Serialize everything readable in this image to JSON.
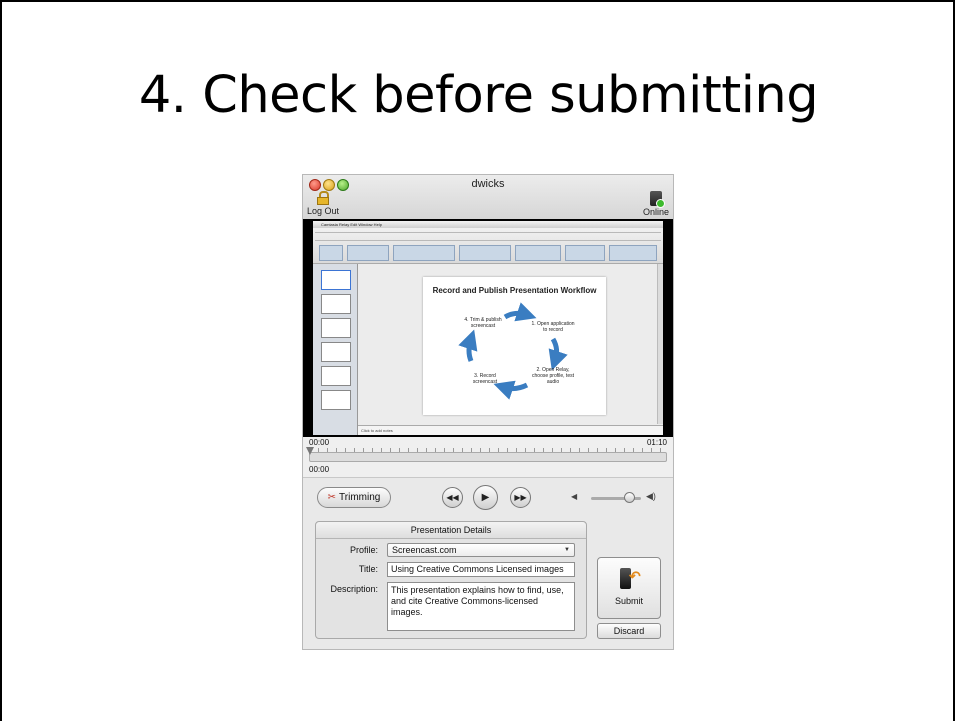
{
  "slide": {
    "title": "4. Check before submitting"
  },
  "window": {
    "title": "dwicks",
    "log_out_label": "Log Out",
    "online_label": "Online"
  },
  "recording": {
    "menubar_text": "Camtasia Relay   Edit   Window   Help",
    "slide_title": "Record and Publish Presentation Workflow",
    "workflow_steps": [
      "1. Open application to record",
      "2. Open Relay, choose profile, test audio",
      "3. Record screencast",
      "4. Trim & publish screencast"
    ],
    "notes_text": "Click to add notes"
  },
  "timeline": {
    "start_time": "00:00",
    "end_time": "01:10",
    "current_time": "00:00"
  },
  "controls": {
    "trim_label": "Trimming",
    "rewind_icon": "rewind-icon",
    "play_icon": "play-icon",
    "forward_icon": "fast-forward-icon"
  },
  "details": {
    "heading": "Presentation Details",
    "profile_label": "Profile:",
    "profile_value": "Screencast.com",
    "title_label": "Title:",
    "title_value": "Using Creative Commons Licensed images",
    "description_label": "Description:",
    "description_value": "This presentation explains how to find, use, and cite Creative Commons-licensed images."
  },
  "actions": {
    "submit_label": "Submit",
    "discard_label": "Discard"
  },
  "colors": {
    "workflow_arrow": "#3a7dc1",
    "submit_arrow": "#e38a1c"
  }
}
